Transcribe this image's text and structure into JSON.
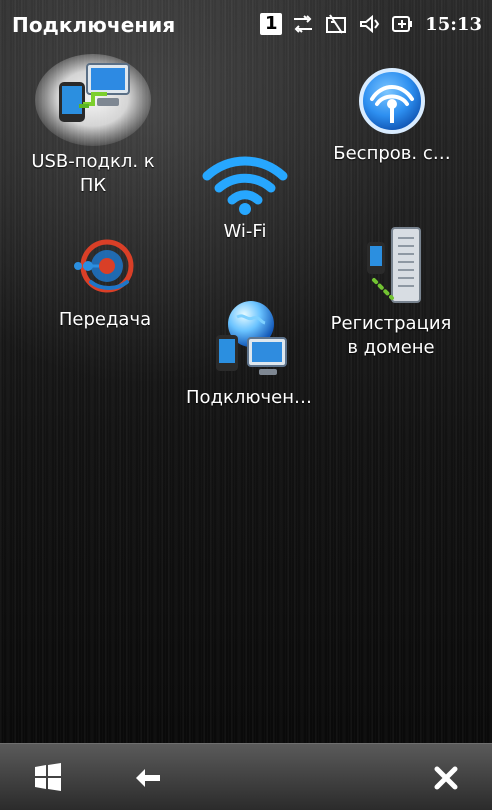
{
  "status_bar": {
    "title": "Подключения",
    "badge": "1",
    "time": "15:13"
  },
  "tiles": {
    "usb": {
      "label": "USB-подкл. к\nПК"
    },
    "wireless": {
      "label": "Беспров. с…"
    },
    "wifi": {
      "label": "Wi-Fi"
    },
    "beam": {
      "label": "Передача"
    },
    "domain": {
      "label": "Регистрация\nв домене"
    },
    "connections": {
      "label": "Подключен…"
    }
  },
  "taskbar": {
    "icons": [
      "windows-start-icon",
      "back-arrow-icon",
      "close-icon"
    ]
  }
}
